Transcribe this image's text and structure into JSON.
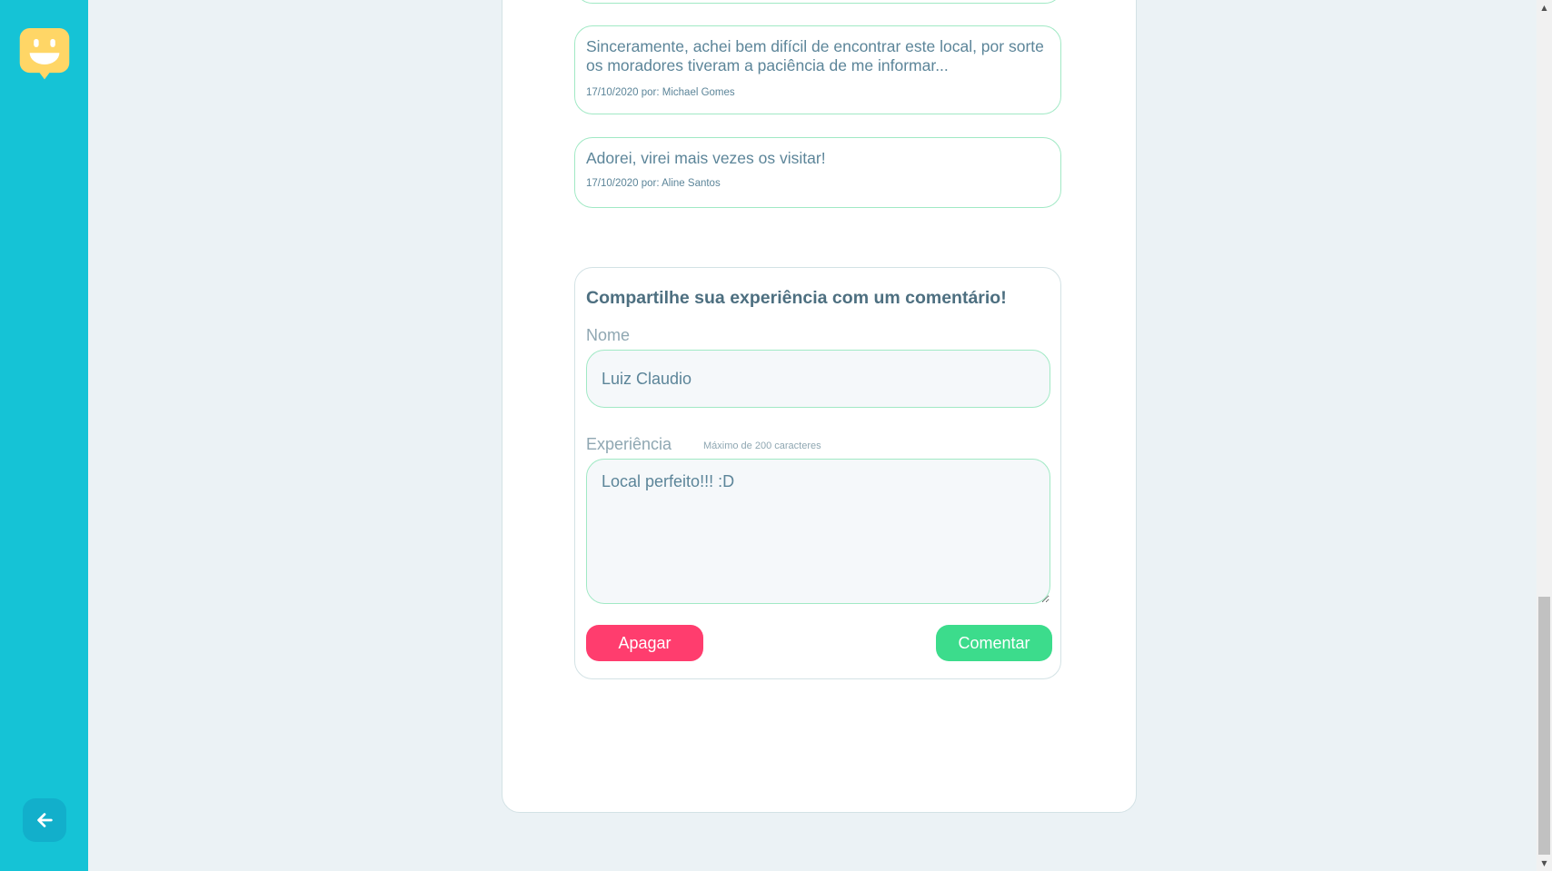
{
  "sidebar": {
    "logo_icon": "happy-face-logo",
    "back_icon": "arrow-left-icon",
    "colors": {
      "background": "#15c3d6",
      "back_button": "#12afcb",
      "logo": "#ffd666"
    }
  },
  "comments": [
    {
      "text": "Sinceramente, achei bem difícil de encontrar este local, por sorte os moradores tiveram a paciência de me informar...",
      "meta": "17/10/2020 por: Michael Gomes"
    },
    {
      "text": "Adorei, virei mais vezes os visitar!",
      "meta": "17/10/2020 por: Aline Santos"
    }
  ],
  "form": {
    "title": "Compartilhe sua experiência com um comentário!",
    "name_label": "Nome",
    "name_value": "Luiz Claudio",
    "experience_label": "Experiência",
    "experience_hint": "Máximo de 200 caracteres",
    "experience_value": "Local perfeito!!! :D",
    "clear_label": "Apagar",
    "submit_label": "Comentar"
  },
  "colors": {
    "clear_button": "#ff3d6e",
    "submit_button": "#3cdc8c",
    "text": "#5c8599",
    "border": "#a1e9c5"
  }
}
